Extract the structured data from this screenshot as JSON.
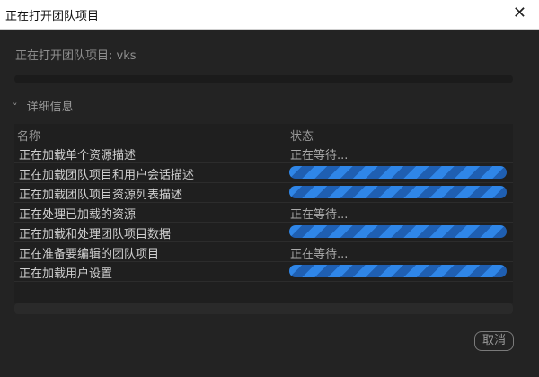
{
  "window": {
    "title": "正在打开团队项目",
    "close_icon": "close-icon"
  },
  "subtitle": "正在打开团队项目: vks",
  "details": {
    "toggle_label": "详细信息",
    "chevron_icon": "chevron-down-icon"
  },
  "table": {
    "headers": {
      "name": "名称",
      "status": "状态"
    },
    "rows": [
      {
        "name": "正在加载单个资源描述",
        "status": "正在等待..."
      },
      {
        "name": "正在加载团队项目和用户会话描述",
        "status": ""
      },
      {
        "name": "正在加载团队项目资源列表描述",
        "status": ""
      },
      {
        "name": "正在处理已加载的资源",
        "status": "正在等待..."
      },
      {
        "name": "正在加载和处理团队项目数据",
        "status": ""
      },
      {
        "name": "正在准备要编辑的团队项目",
        "status": "正在等待..."
      },
      {
        "name": "正在加载用户设置",
        "status": ""
      }
    ]
  },
  "buttons": {
    "cancel": "取消"
  },
  "colors": {
    "background": "#232323",
    "progress_stripe_a": "#2f86e8",
    "progress_stripe_b": "#1f5fb2"
  }
}
